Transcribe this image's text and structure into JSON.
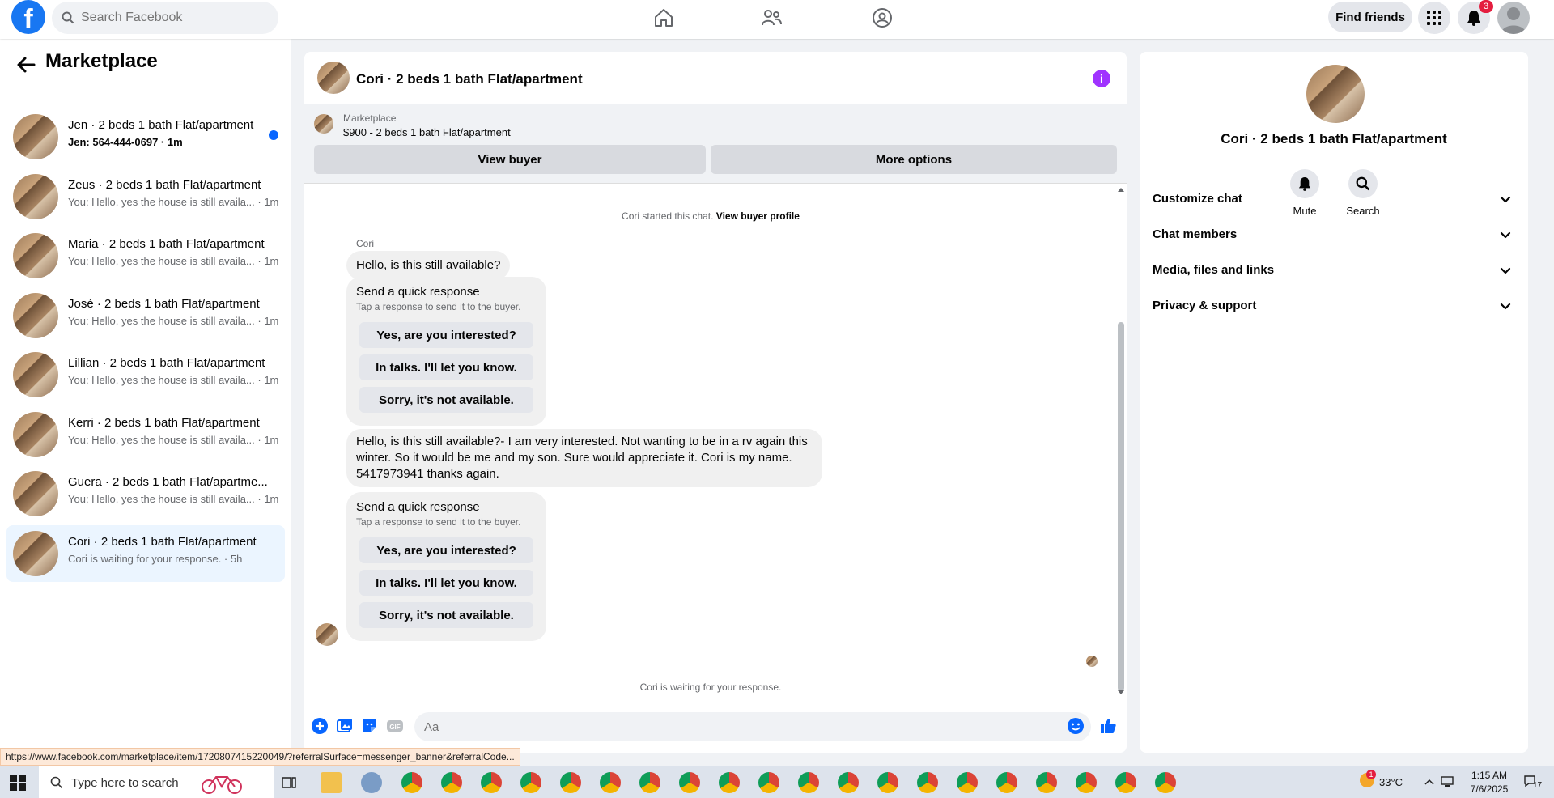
{
  "topbar": {
    "logo_letter": "f",
    "search_placeholder": "Search Facebook",
    "find_friends_label": "Find friends",
    "notification_count": "3",
    "nav_icons": [
      "home-icon",
      "friends-icon",
      "groups-icon"
    ]
  },
  "sidebar": {
    "title": "Marketplace",
    "conversations": [
      {
        "name": "Jen · 2 beds 1 bath Flat/apartment",
        "snippet": "Jen: 564-444-0697",
        "time": "1m",
        "unread": true
      },
      {
        "name": "Zeus · 2 beds 1 bath Flat/apartment",
        "snippet": "You: Hello, yes the house is still availa...",
        "time": "1m",
        "unread": false
      },
      {
        "name": "Maria · 2 beds 1 bath Flat/apartment",
        "snippet": "You: Hello, yes the house is still availa...",
        "time": "1m",
        "unread": false
      },
      {
        "name": "José · 2 beds 1 bath Flat/apartment",
        "snippet": "You: Hello, yes the house is still availa...",
        "time": "1m",
        "unread": false
      },
      {
        "name": "Lillian · 2 beds 1 bath Flat/apartment",
        "snippet": "You: Hello, yes the house is still availa...",
        "time": "1m",
        "unread": false
      },
      {
        "name": "Kerri · 2 beds 1 bath Flat/apartment",
        "snippet": "You: Hello, yes the house is still availa...",
        "time": "1m",
        "unread": false
      },
      {
        "name": "Guera · 2 beds 1 bath Flat/apartme...",
        "snippet": "You: Hello, yes the house is still availa...",
        "time": "1m",
        "unread": false
      },
      {
        "name": "Cori · 2 beds 1 bath Flat/apartment",
        "snippet": "Cori is waiting for your response.",
        "time": "5h",
        "unread": false
      }
    ]
  },
  "chat": {
    "title": "Cori · 2 beds 1 bath Flat/apartment",
    "banner": {
      "label": "Marketplace",
      "listing": "$900 - 2 beds 1 bath Flat/apartment",
      "view_buyer": "View buyer",
      "more_options": "More options"
    },
    "started_note": "Cori started this chat.",
    "view_buyer_profile": "View buyer profile",
    "sender_name": "Cori",
    "message_1": "Hello, is this still available?",
    "message_2": "Hello, is this still available?- I am very interested.  Not wanting to be in a rv again this winter. So it would be me and my son.  Sure would appreciate it. Cori is my name. 5417973941 thanks again.",
    "quick_response": {
      "title": "Send a quick response",
      "subtitle": "Tap a response to send it to the buyer.",
      "options": [
        "Yes, are you interested?",
        "In talks. I'll let you know.",
        "Sorry, it's not available."
      ]
    },
    "waiting_note": "Cori is waiting for your response.",
    "composer_placeholder": "Aa"
  },
  "details": {
    "title": "Cori · 2 beds 1 bath Flat/apartment",
    "actions": [
      {
        "label": "Mute",
        "icon": "bell-icon"
      },
      {
        "label": "Search",
        "icon": "search-icon"
      }
    ],
    "sections": [
      "Customize chat",
      "Chat members",
      "Media, files and links",
      "Privacy & support"
    ]
  },
  "status_url": "https://www.facebook.com/marketplace/item/1720807415220049/?referralSurface=messenger_banner&referralCode...",
  "taskbar": {
    "search_placeholder": "Type here to search",
    "temperature": "33°C",
    "time": "1:15 AM",
    "date": "7/6/2025",
    "notif_count": "17",
    "weather_badge": "1"
  },
  "colors": {
    "brand": "#1877f2",
    "unread": "#0866ff",
    "info": "#a033ff"
  }
}
